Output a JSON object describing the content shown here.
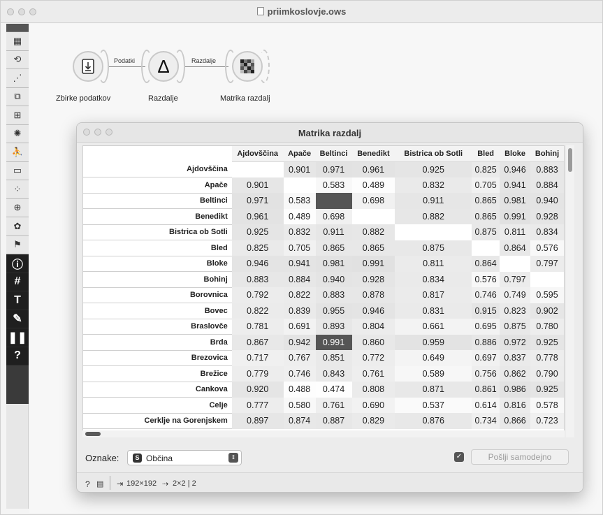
{
  "main_window": {
    "title": "priimkoslovje.ows"
  },
  "toolbox": {
    "items": [
      "table-icon",
      "refresh-icon",
      "scatter-plot-icon",
      "tree-icon",
      "grid-select-icon",
      "clusters-icon",
      "figure-icon",
      "image-icon",
      "dots-icon",
      "globe-icon",
      "paw-icon",
      "graduation-cap-icon",
      "info-icon",
      "hash-icon",
      "text-icon",
      "pen-icon",
      "pause-icon",
      "help-icon"
    ],
    "glyphs": [
      "▦",
      "⟲",
      "⋰",
      "⧉",
      "⊞",
      "✺",
      "⛹",
      "▭",
      "⁘",
      "⊕",
      "✿",
      "⚑",
      "ⓘ",
      "#",
      "T",
      "✎",
      "❚❚",
      "?"
    ]
  },
  "workflow": {
    "nodes": [
      {
        "label": "Zbirke podatkov",
        "icon": "download-file-icon"
      },
      {
        "label": "Razdalje",
        "icon": "delta-icon",
        "glyph": "Δ"
      },
      {
        "label": "Matrika razdalj",
        "icon": "distance-matrix-icon"
      }
    ],
    "links": [
      {
        "label": "Podatki"
      },
      {
        "label": "Razdalje"
      }
    ]
  },
  "dialog": {
    "title": "Matrika razdalj",
    "columns": [
      "Ajdovščina",
      "Apače",
      "Beltinci",
      "Benedikt",
      "Bistrica ob Sotli",
      "Bled",
      "Bloke",
      "Bohinj"
    ],
    "rows": [
      {
        "label": "Ajdovščina",
        "values": [
          "",
          "0.901",
          "0.971",
          "0.961",
          "0.925",
          "0.825",
          "0.946",
          "0.883"
        ]
      },
      {
        "label": "Apače",
        "values": [
          "0.901",
          "",
          "0.583",
          "0.489",
          "0.832",
          "0.705",
          "0.941",
          "0.884"
        ]
      },
      {
        "label": "Beltinci",
        "values": [
          "0.971",
          "0.583",
          "",
          "0.698",
          "0.911",
          "0.865",
          "0.981",
          "0.940"
        ]
      },
      {
        "label": "Benedikt",
        "values": [
          "0.961",
          "0.489",
          "0.698",
          "",
          "0.882",
          "0.865",
          "0.991",
          "0.928"
        ]
      },
      {
        "label": "Bistrica ob Sotli",
        "values": [
          "0.925",
          "0.832",
          "0.911",
          "0.882",
          "",
          "0.875",
          "0.811",
          "0.834"
        ]
      },
      {
        "label": "Bled",
        "values": [
          "0.825",
          "0.705",
          "0.865",
          "0.865",
          "0.875",
          "",
          "0.864",
          "0.576"
        ]
      },
      {
        "label": "Bloke",
        "values": [
          "0.946",
          "0.941",
          "0.981",
          "0.991",
          "0.811",
          "0.864",
          "",
          "0.797"
        ]
      },
      {
        "label": "Bohinj",
        "values": [
          "0.883",
          "0.884",
          "0.940",
          "0.928",
          "0.834",
          "0.576",
          "0.797",
          ""
        ]
      },
      {
        "label": "Borovnica",
        "values": [
          "0.792",
          "0.822",
          "0.883",
          "0.878",
          "0.817",
          "0.746",
          "0.749",
          "0.595"
        ]
      },
      {
        "label": "Bovec",
        "values": [
          "0.822",
          "0.839",
          "0.955",
          "0.946",
          "0.831",
          "0.915",
          "0.823",
          "0.902"
        ]
      },
      {
        "label": "Braslovče",
        "values": [
          "0.781",
          "0.691",
          "0.893",
          "0.804",
          "0.661",
          "0.695",
          "0.875",
          "0.780"
        ]
      },
      {
        "label": "Brda",
        "values": [
          "0.867",
          "0.942",
          "0.991",
          "0.860",
          "0.959",
          "0.886",
          "0.972",
          "0.925"
        ]
      },
      {
        "label": "Brezovica",
        "values": [
          "0.717",
          "0.767",
          "0.851",
          "0.772",
          "0.649",
          "0.697",
          "0.837",
          "0.778"
        ]
      },
      {
        "label": "Brežice",
        "values": [
          "0.779",
          "0.746",
          "0.843",
          "0.761",
          "0.589",
          "0.756",
          "0.862",
          "0.790"
        ]
      },
      {
        "label": "Cankova",
        "values": [
          "0.920",
          "0.488",
          "0.474",
          "0.808",
          "0.871",
          "0.861",
          "0.986",
          "0.925"
        ]
      },
      {
        "label": "Celje",
        "values": [
          "0.777",
          "0.580",
          "0.761",
          "0.690",
          "0.537",
          "0.614",
          "0.816",
          "0.578"
        ]
      },
      {
        "label": "Cerklje na Gorenjskem",
        "values": [
          "0.897",
          "0.874",
          "0.887",
          "0.829",
          "0.876",
          "0.734",
          "0.866",
          "0.723"
        ]
      }
    ],
    "selected_cells": [
      [
        2,
        2
      ],
      [
        11,
        2
      ]
    ],
    "selected_color": "#555555",
    "oznake_label": "Oznake:",
    "oznake_value": "Občina",
    "oznake_badge": "S",
    "auto_send_checked": true,
    "send_button": "Pošlji samodejno",
    "status": {
      "input": "192×192",
      "output": "2×2 | 2"
    }
  }
}
